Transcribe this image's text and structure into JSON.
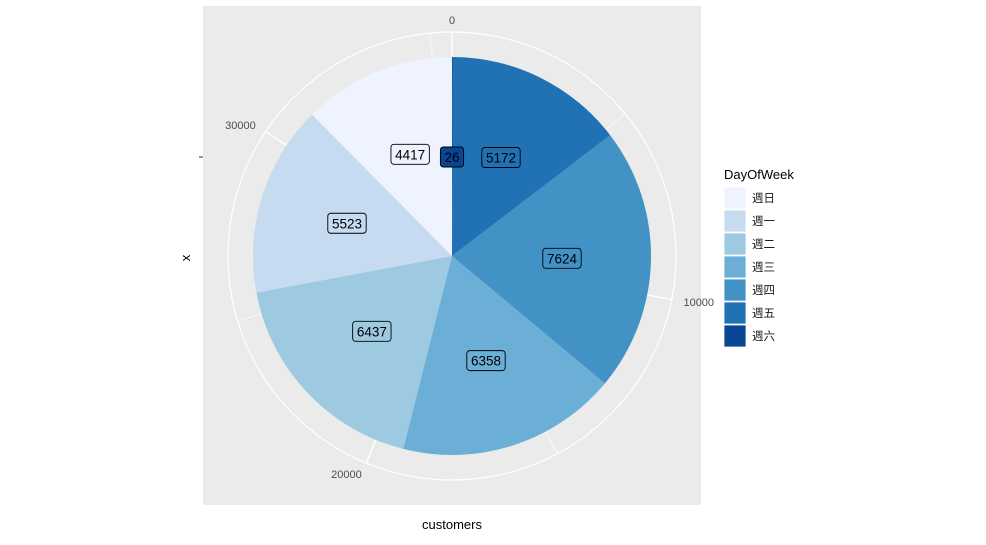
{
  "chart_data": {
    "type": "pie",
    "coord": "polar",
    "xlabel": "customers",
    "ylabel": "x",
    "legend": {
      "title": "DayOfWeek",
      "position": "right"
    },
    "categories": [
      "週日",
      "週一",
      "週二",
      "週三",
      "週四",
      "週五",
      "週六"
    ],
    "values": [
      4417,
      5523,
      6437,
      6358,
      7624,
      5172,
      26
    ],
    "data_labels": [
      "4417",
      "5523",
      "6437",
      "6358",
      "7624",
      "5172",
      "26"
    ],
    "colors": [
      "#EFF3FF",
      "#C6DBEF",
      "#9ECAE1",
      "#6BAED6",
      "#4292C6",
      "#2171B5",
      "#084594"
    ],
    "angular_ticks": [
      "0",
      "10000",
      "20000",
      "30000"
    ],
    "angular_tick_values": [
      0,
      10000,
      20000,
      30000
    ],
    "panel_background": "#EBEBEB",
    "grid": true
  }
}
